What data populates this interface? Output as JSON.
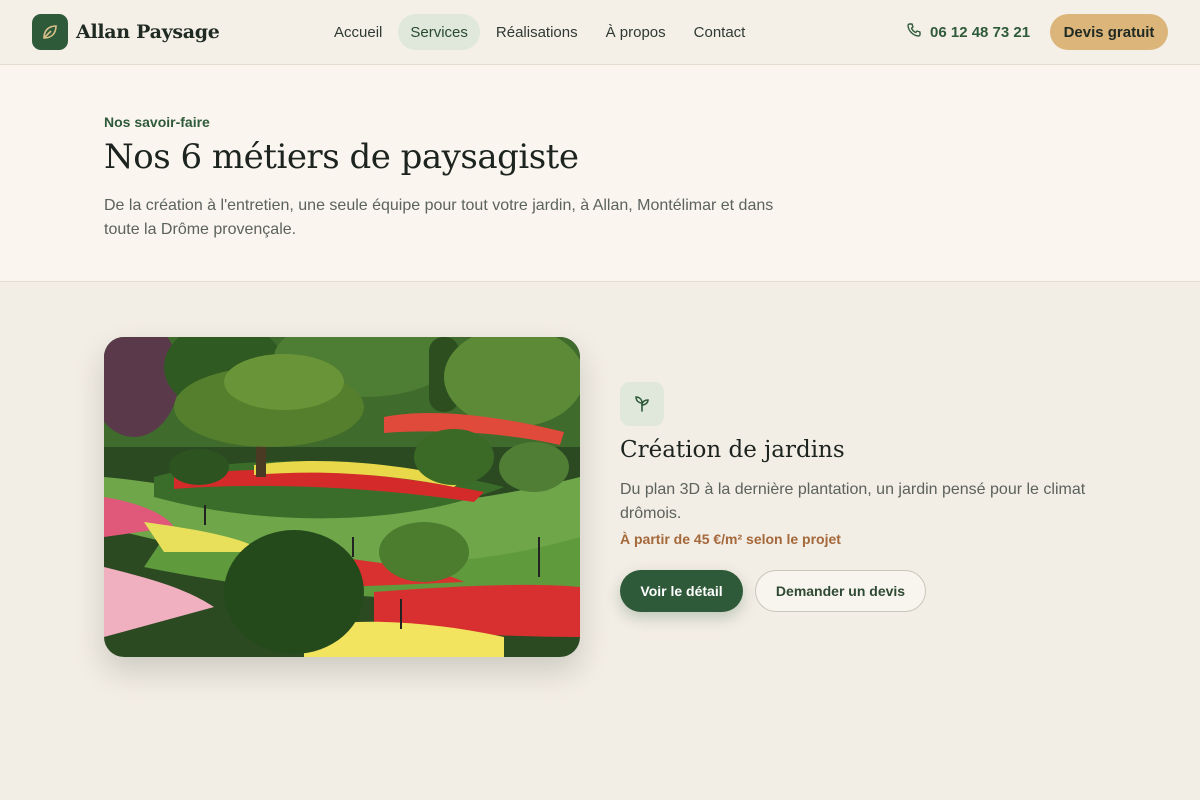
{
  "header": {
    "brand": "Allan Paysage",
    "nav": [
      "Accueil",
      "Services",
      "Réalisations",
      "À propos",
      "Contact"
    ],
    "active_nav": "Services",
    "phone": "06 12 48 73 21",
    "cta": "Devis gratuit"
  },
  "hero": {
    "eyebrow": "Nos savoir-faire",
    "title": "Nos 6 métiers de paysagiste",
    "subtitle": "De la création à l'entretien, une seule équipe pour tout votre jardin, à Allan, Montélimar et dans toute la Drôme provençale."
  },
  "service": {
    "title": "Création de jardins",
    "description": "Du plan 3D à la dernière plantation, un jardin pensé pour le climat drômois.",
    "price": "À partir de 45 €/m² selon le projet",
    "primary_button": "Voir le détail",
    "secondary_button": "Demander un devis",
    "icon": "sprout-icon"
  },
  "icons": {
    "logo": "leaf-icon",
    "phone": "phone-icon"
  },
  "colors": {
    "brand_green": "#2f5a3a",
    "accent_gold": "#dcb57b",
    "price_brown": "#a4683a",
    "nav_active_bg": "#dfe8da"
  }
}
